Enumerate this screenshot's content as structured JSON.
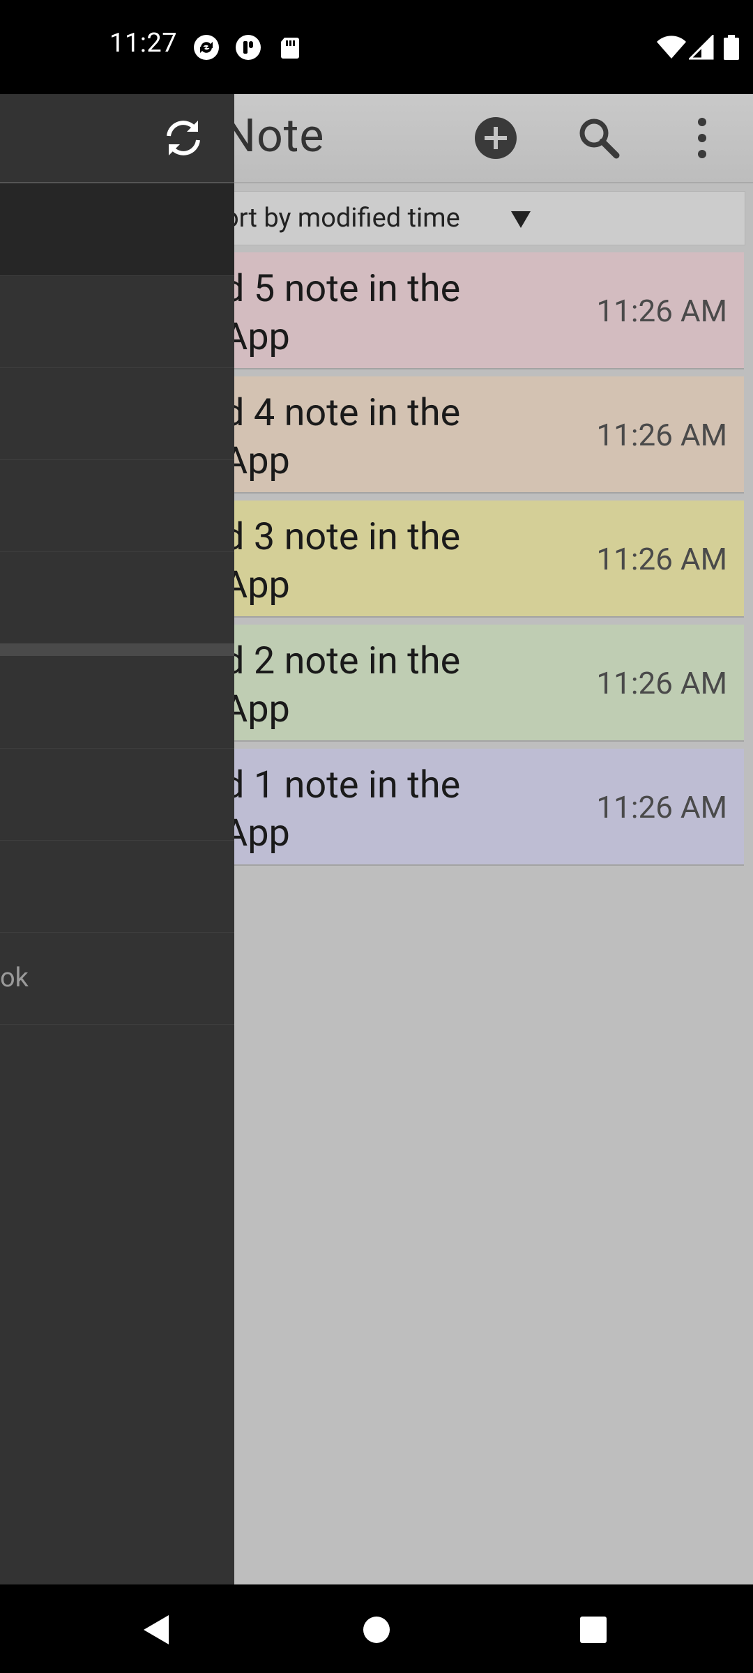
{
  "status_bar": {
    "time": "11:27"
  },
  "app_bar": {
    "title": "Note"
  },
  "sort": {
    "label": "ort by modified time"
  },
  "notes": [
    {
      "title_line1": "d 5 note in the",
      "title_line2": "App",
      "time": "11:26 AM",
      "color": "#d3bcc0"
    },
    {
      "title_line1": "d 4 note in the",
      "title_line2": "App",
      "time": "11:26 AM",
      "color": "#d3c2b2"
    },
    {
      "title_line1": "d 3 note in the",
      "title_line2": "App",
      "time": "11:26 AM",
      "color": "#d4cf97"
    },
    {
      "title_line1": "d 2 note in the",
      "title_line2": "App",
      "time": "11:26 AM",
      "color": "#bfcdb3"
    },
    {
      "title_line1": "d 1 note in the",
      "title_line2": "App",
      "time": "11:26 AM",
      "color": "#bebdd3"
    }
  ],
  "drawer": {
    "partial_label": "ok"
  }
}
